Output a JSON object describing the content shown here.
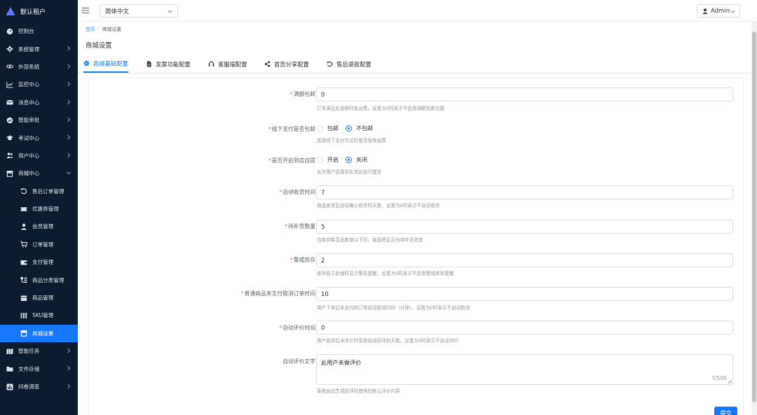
{
  "brand": {
    "title": "默认租户"
  },
  "sidebar": {
    "items": [
      {
        "label": "控制台",
        "icon": "dashboard-icon",
        "has_children": false
      },
      {
        "label": "系统管理",
        "icon": "gear-icon",
        "has_children": true
      },
      {
        "label": "外部系统",
        "icon": "link-icon",
        "has_children": true
      },
      {
        "label": "监控中心",
        "icon": "line-chart-icon",
        "has_children": true
      },
      {
        "label": "消息中心",
        "icon": "envelope-icon",
        "has_children": true
      },
      {
        "label": "智能审批",
        "icon": "approval-icon",
        "has_children": true
      },
      {
        "label": "考试中心",
        "icon": "graduation-cap-icon",
        "has_children": true
      },
      {
        "label": "用户中心",
        "icon": "users-icon",
        "has_children": true
      },
      {
        "label": "商城中心",
        "icon": "store-icon",
        "has_children": true,
        "open": true
      }
    ],
    "sub_items": [
      {
        "label": "售后订单管理",
        "icon": "undo-icon"
      },
      {
        "label": "优惠券管理",
        "icon": "ticket-icon"
      },
      {
        "label": "会员管理",
        "icon": "user-icon"
      },
      {
        "label": "订单管理",
        "icon": "cart-icon"
      },
      {
        "label": "支付管理",
        "icon": "wallet-icon"
      },
      {
        "label": "商品分类管理",
        "icon": "category-icon"
      },
      {
        "label": "商品管理",
        "icon": "box-icon"
      },
      {
        "label": "SKU管理",
        "icon": "barcode-icon"
      },
      {
        "label": "商城设置",
        "icon": "shop-icon",
        "active": true
      }
    ],
    "bottom_items": [
      {
        "label": "智能任务",
        "icon": "map-icon",
        "has_children": true
      },
      {
        "label": "文件存储",
        "icon": "folder-icon",
        "has_children": true
      },
      {
        "label": "问卷调查",
        "icon": "poll-icon",
        "has_children": true
      }
    ]
  },
  "header": {
    "language": "简体中文",
    "user": "Admin"
  },
  "breadcrumb": {
    "home": "首页",
    "sep": "/",
    "current": "商城设置"
  },
  "page_title": "商城设置",
  "tabs": [
    {
      "label": "商城基础配置",
      "icon": "gear-icon",
      "active": true
    },
    {
      "label": "发票功能配置",
      "icon": "file-icon"
    },
    {
      "label": "客服端配置",
      "icon": "headset-icon"
    },
    {
      "label": "首页分享配置",
      "icon": "share-icon"
    },
    {
      "label": "售后退款配置",
      "icon": "undo-icon"
    }
  ],
  "form": {
    "free_shipping": {
      "label": "满额包邮",
      "value": "0",
      "help": "订单满足此金额时免运费，设置为0时表示不启用满额包邮功能"
    },
    "offline_pay": {
      "label": "线下支付是否包邮",
      "options": [
        "包邮",
        "不包邮"
      ],
      "selected": "不包邮",
      "help": "选择线下支付方式时是否免除运费"
    },
    "store_pickup": {
      "label": "是否开启到店自提",
      "options": [
        "开启",
        "关闭"
      ],
      "selected": "关闭",
      "help": "允许用户选择到实体店自行提货"
    },
    "auto_receive": {
      "label": "自动收货时间",
      "value": "7",
      "help": "商品发货后自动确认收货的天数，设置为0时表示不自动收货"
    },
    "restock_qty": {
      "label": "待补货数量",
      "value": "5",
      "help": "当库存降至此数值以下时，商品将显示为待补货状态"
    },
    "warn_stock": {
      "label": "警戒库存",
      "value": "2",
      "help": "库存低于此值时显示警告提醒，设置为0时表示不启用警戒库存提醒"
    },
    "unpaid_cancel": {
      "label": "普通商品未支付取消订单时间",
      "value": "10",
      "help": "用户下单后未支付的订单自动取消时间（分钟），设置为0时表示不自动取消"
    },
    "auto_review": {
      "label": "自动评价时间",
      "value": "0",
      "help": "用户收货后未评价时系统自动好评的天数，设置为0时表示不自动评价"
    },
    "review_text": {
      "label": "自动评价文字",
      "value": "此用户未做评价",
      "counter": "7/500",
      "help": "系统自动生成好评时使用的默认评价内容"
    }
  },
  "submit_label": "提交",
  "colors": {
    "primary": "#1677ff",
    "sidebar_bg": "#0c1b2e",
    "required": "#f56c6c"
  }
}
